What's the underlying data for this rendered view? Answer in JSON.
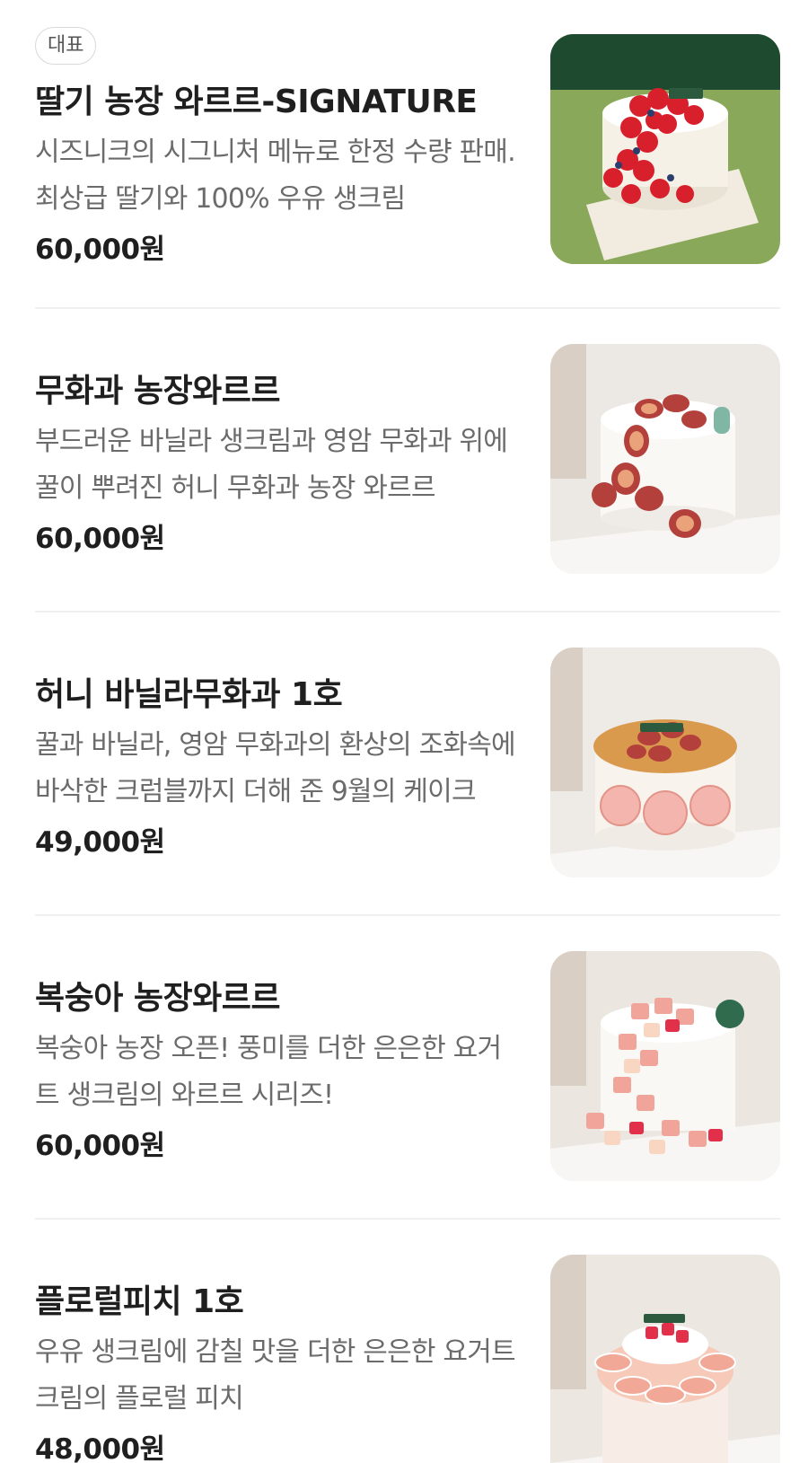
{
  "menu": {
    "items": [
      {
        "badge": "대표",
        "name": "딸기 농장 와르르-SIGNATURE",
        "description": "시즈니크의 시그니처 메뉴로 한정 수량 판매. 최상급 딸기와 100% 우유 생크림",
        "price": "60,000원",
        "image_icon": "strawberry-cake-image"
      },
      {
        "name": "무화과 농장와르르",
        "description": "부드러운 바닐라 생크림과 영암 무화과 위에 꿀이 뿌려진 허니 무화과 농장 와르르",
        "price": "60,000원",
        "image_icon": "fig-cake-image"
      },
      {
        "name": "허니 바닐라무화과 1호",
        "description": "꿀과 바닐라, 영암 무화과의 환상의 조화속에 바삭한 크럼블까지 더해 준 9월의 케이크",
        "price": "49,000원",
        "image_icon": "honey-fig-crumble-cake-image"
      },
      {
        "name": "복숭아 농장와르르",
        "description": "복숭아 농장 오픈! 풍미를 더한 은은한 요거트 생크림의 와르르 시리즈!",
        "price": "60,000원",
        "image_icon": "peach-cake-image"
      },
      {
        "name": "플로럴피치 1호",
        "description": "우유 생크림에 감칠 맛을 더한 은은한 요거트 크림의 플로럴 피치",
        "price": "48,000원",
        "image_icon": "floral-peach-cake-image"
      }
    ]
  },
  "colors": {
    "text_primary": "#1f1f1f",
    "text_secondary": "#6b6b6b",
    "divider": "#f0f0f0",
    "badge_border": "#d9d9d9"
  }
}
